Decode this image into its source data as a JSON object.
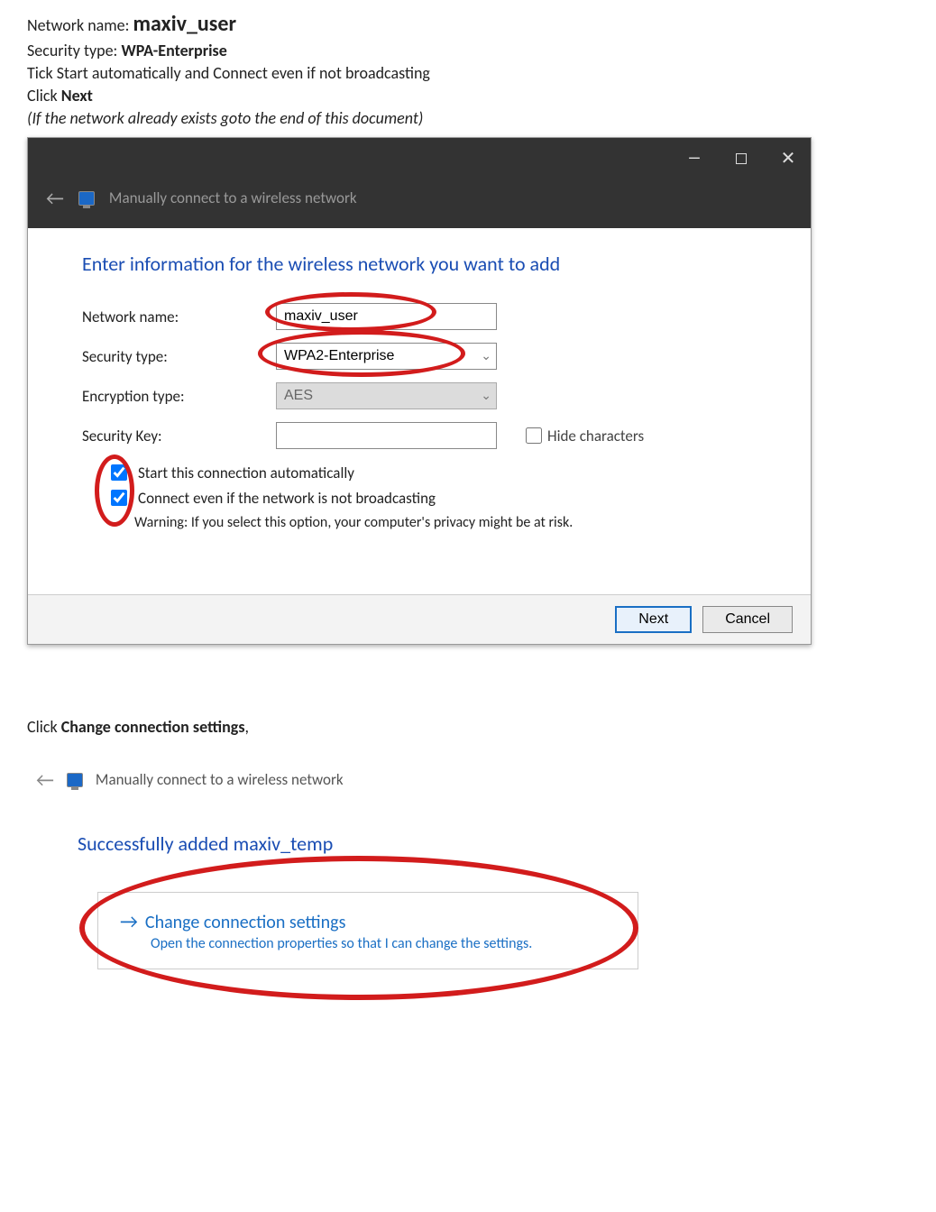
{
  "intro": {
    "line1_label": "Network name: ",
    "line1_value": "maxiv_user",
    "line2_label": "Security type: ",
    "line2_value": "WPA-Enterprise",
    "line3": "Tick Start automatically and Connect even if not broadcasting",
    "line4_a": "Click ",
    "line4_b": "Next",
    "line5": "(If the network already exists goto the end of this document)"
  },
  "wizard1": {
    "title": "Manually connect to a wireless network",
    "heading": "Enter information for the wireless network you want to add",
    "labels": {
      "network_name": "Network name:",
      "security_type": "Security type:",
      "encryption_type": "Encryption type:",
      "security_key": "Security Key:",
      "hide_chars": "Hide characters",
      "start_auto": "Start this connection automatically",
      "connect_nb": "Connect even if the network is not broadcasting",
      "warning": "Warning: If you select this option, your computer's privacy might be at risk."
    },
    "values": {
      "network_name": "maxiv_user",
      "security_type": "WPA2-Enterprise",
      "encryption_type": "AES",
      "security_key": ""
    },
    "buttons": {
      "next": "Next",
      "cancel": "Cancel"
    }
  },
  "instr2_a": "Click ",
  "instr2_b": "Change connection settings",
  "instr2_c": ",",
  "wizard2": {
    "title": "Manually connect to a wireless network",
    "heading": "Successfully added maxiv_temp",
    "link_title": "Change connection settings",
    "link_sub": "Open the connection properties so that I can change the settings."
  }
}
